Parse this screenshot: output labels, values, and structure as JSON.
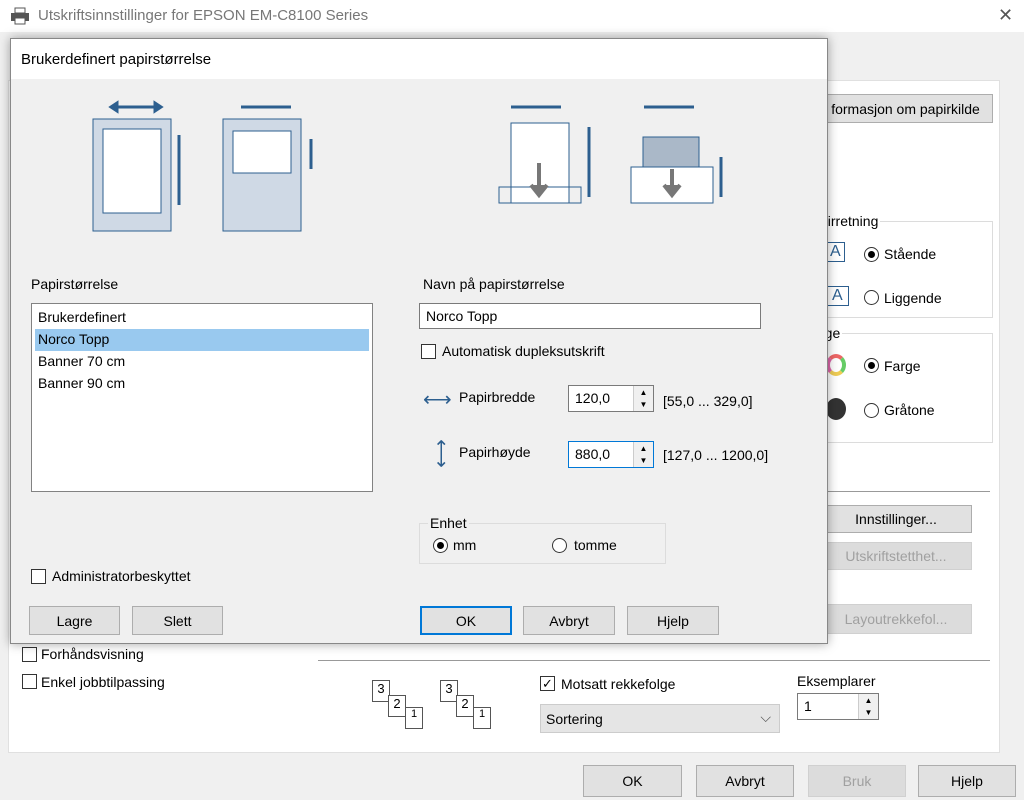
{
  "window": {
    "title": "Utskriftsinnstillinger for EPSON EM-C8100 Series",
    "close": "✕"
  },
  "background": {
    "paper_source_button": "formasjon om papirkilde",
    "orientation": {
      "legend": "pirretning",
      "portrait": "Stående",
      "landscape": "Liggende",
      "icon_letter": "A",
      "selected": "portrait"
    },
    "color": {
      "legend": "rge",
      "color": "Farge",
      "grayscale": "Gråtone",
      "selected": "color"
    },
    "settings_button": "Innstillinger...",
    "density_button": "Utskriftstetthet...",
    "layout_button": "Layoutrekkefol...",
    "preview": {
      "label": "Forhåndsvisning",
      "checked": false
    },
    "simple_job": {
      "label": "Enkel jobbtilpassing",
      "checked": false
    },
    "collate_pages": [
      "3",
      "2",
      "1"
    ],
    "reverse_order": {
      "label": "Motsatt rekkefolge",
      "checked": true
    },
    "collate_select": "Sortering",
    "copies": {
      "label": "Eksemplarer",
      "value": "1"
    },
    "buttons": {
      "ok": "OK",
      "cancel": "Avbryt",
      "apply": "Bruk",
      "help": "Hjelp"
    }
  },
  "dialog": {
    "title": "Brukerdefinert papirstørrelse",
    "paper_size_label": "Papirstørrelse",
    "paper_sizes": [
      "Brukerdefinert",
      "Norco Topp",
      "Banner 70 cm",
      "Banner 90 cm"
    ],
    "selected_index": 1,
    "name_label": "Navn på papirstørrelse",
    "name_value": "Norco Topp",
    "duplex": {
      "label": "Automatisk dupleksutskrift",
      "checked": false
    },
    "width": {
      "label": "Papirbredde",
      "value": "120,0",
      "range": "[55,0 ... 329,0]"
    },
    "height": {
      "label": "Papirhøyde",
      "value": "880,0",
      "range": "[127,0 ... 1200,0]"
    },
    "unit": {
      "legend": "Enhet",
      "mm": "mm",
      "inch": "tomme",
      "selected": "mm"
    },
    "admin": {
      "label": "Administratorbeskyttet",
      "checked": false
    },
    "buttons": {
      "save": "Lagre",
      "delete": "Slett",
      "ok": "OK",
      "cancel": "Avbryt",
      "help": "Hjelp"
    },
    "colors": {
      "accent": "#0078d7",
      "selection": "#99c9ef",
      "icon_blue": "#2d5f8f"
    }
  }
}
